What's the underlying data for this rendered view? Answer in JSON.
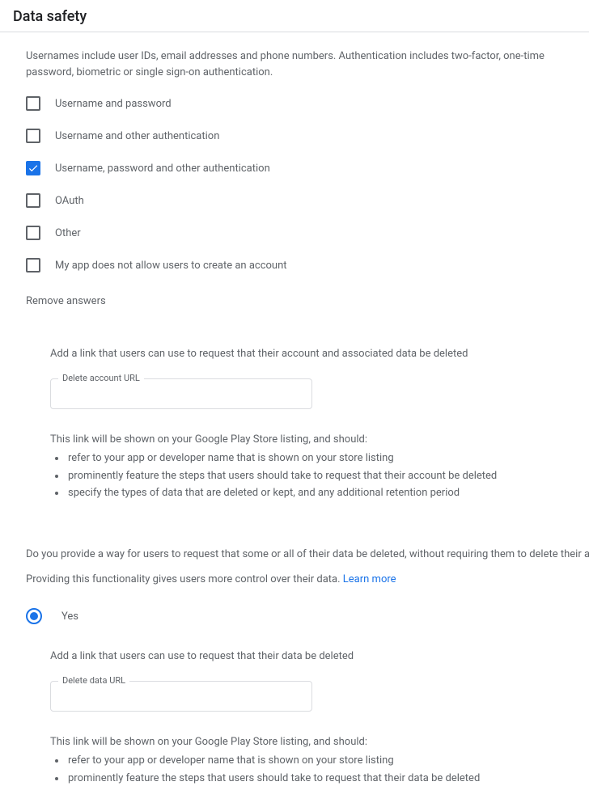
{
  "header": {
    "title": "Data safety"
  },
  "intro": "Usernames include user IDs, email addresses and phone numbers. Authentication includes two-factor, one-time password, biometric or single sign-on authentication.",
  "checkboxes": [
    {
      "label": "Username and password",
      "checked": false
    },
    {
      "label": "Username and other authentication",
      "checked": false
    },
    {
      "label": "Username, password and other authentication",
      "checked": true
    },
    {
      "label": "OAuth",
      "checked": false
    },
    {
      "label": "Other",
      "checked": false
    },
    {
      "label": "My app does not allow users to create an account",
      "checked": false
    }
  ],
  "removeAnswers": "Remove answers",
  "deleteAccount": {
    "heading": "Add a link that users can use to request that their account and associated data be deleted",
    "fieldLabel": "Delete account URL",
    "value": "",
    "info": "This link will be shown on your Google Play Store listing, and should:",
    "bullets": [
      "refer to your app or developer name that is shown on your store listing",
      "prominently feature the steps that users should take to request that their account be deleted",
      "specify the types of data that are deleted or kept, and any additional retention period"
    ]
  },
  "dataDeletion": {
    "question": "Do you provide a way for users to request that some or all of their data be deleted, without requiring them to delete their account? (Optional)",
    "subtext": "Providing this functionality gives users more control over their data. ",
    "learnMore": "Learn more",
    "radio": {
      "label": "Yes",
      "selected": true
    },
    "heading": "Add a link that users can use to request that their data be deleted",
    "fieldLabel": "Delete data URL",
    "value": "",
    "info": "This link will be shown on your Google Play Store listing, and should:",
    "bullets": [
      "refer to your app or developer name that is shown on your store listing",
      "prominently feature the steps that users should take to request that their data be deleted"
    ]
  }
}
